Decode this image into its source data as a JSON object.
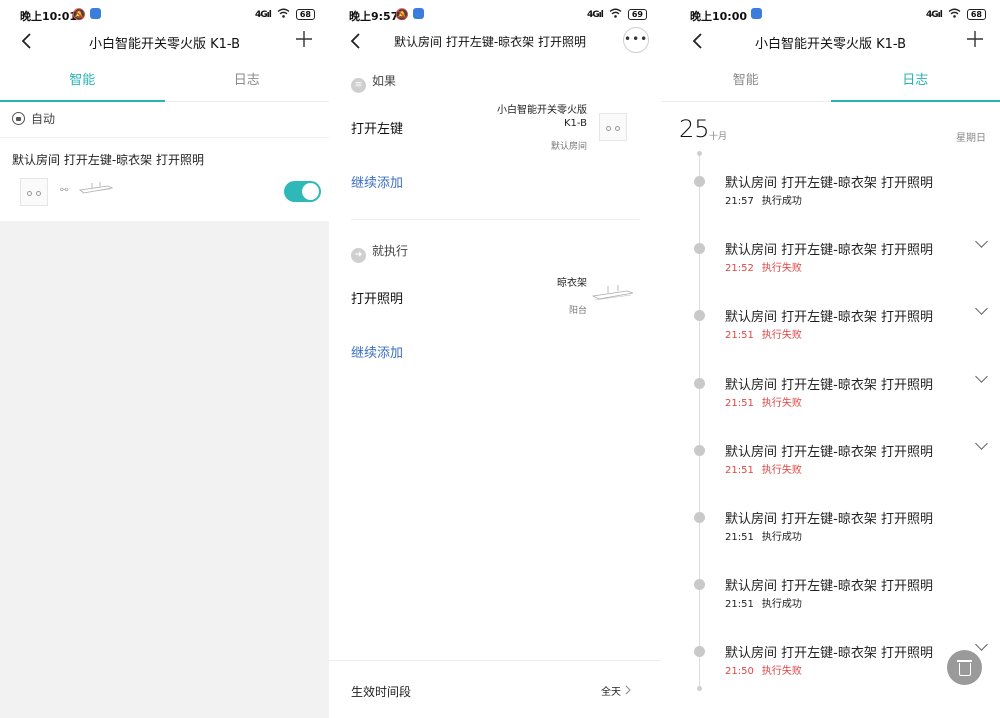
{
  "colors": {
    "accent": "#29b3b3",
    "link": "#3a6fc4",
    "fail": "#e14545",
    "success_text": "#222222"
  },
  "screens": [
    {
      "status": {
        "time": "晚上10:01",
        "signal": "4Gıl",
        "battery": "68"
      },
      "nav": {
        "title": "小白智能开关零火版 K1-B",
        "back_icon": "chevron-left-icon",
        "action_icon": "plus-icon"
      },
      "tabs": [
        {
          "label": "智能",
          "active": true
        },
        {
          "label": "日志",
          "active": false
        }
      ],
      "section": {
        "label": "自动"
      },
      "automation": {
        "name": "默认房间 打开左键-晾衣架 打开照明",
        "enabled": true
      }
    },
    {
      "status": {
        "time": "晚上9:57",
        "signal": "4Gıl",
        "battery": "69"
      },
      "nav": {
        "title": "默认房间 打开左键-晾衣架 打开照明",
        "back_icon": "chevron-left-icon",
        "action_icon": "more-icon"
      },
      "if_section": {
        "label": "如果"
      },
      "condition": {
        "action": "打开左键",
        "device_line1": "小白智能开关零火版",
        "device_line2": "K1-B",
        "room": "默认房间"
      },
      "add_more_1": "继续添加",
      "then_section": {
        "label": "就执行"
      },
      "task": {
        "action": "打开照明",
        "device": "晾衣架",
        "room": "阳台"
      },
      "add_more_2": "继续添加",
      "footer": {
        "label": "生效时间段",
        "value": "全天"
      }
    },
    {
      "status": {
        "time": "晚上10:00",
        "signal": "4Gıl",
        "battery": "68"
      },
      "nav": {
        "title": "小白智能开关零火版 K1-B",
        "back_icon": "chevron-left-icon",
        "action_icon": "plus-icon"
      },
      "tabs": [
        {
          "label": "智能",
          "active": false
        },
        {
          "label": "日志",
          "active": true
        }
      ],
      "date": {
        "day": "25",
        "month": "十月",
        "weekday": "星期日"
      },
      "logs": [
        {
          "title": "默认房间 打开左键-晾衣架 打开照明",
          "time": "21:57",
          "status": "执行成功",
          "result": "success",
          "expandable": false
        },
        {
          "title": "默认房间 打开左键-晾衣架 打开照明",
          "time": "21:52",
          "status": "执行失败",
          "result": "fail",
          "expandable": true
        },
        {
          "title": "默认房间 打开左键-晾衣架 打开照明",
          "time": "21:51",
          "status": "执行失败",
          "result": "fail",
          "expandable": true
        },
        {
          "title": "默认房间 打开左键-晾衣架 打开照明",
          "time": "21:51",
          "status": "执行失败",
          "result": "fail",
          "expandable": true
        },
        {
          "title": "默认房间 打开左键-晾衣架 打开照明",
          "time": "21:51",
          "status": "执行失败",
          "result": "fail",
          "expandable": true
        },
        {
          "title": "默认房间 打开左键-晾衣架 打开照明",
          "time": "21:51",
          "status": "执行成功",
          "result": "success",
          "expandable": false
        },
        {
          "title": "默认房间 打开左键-晾衣架 打开照明",
          "time": "21:51",
          "status": "执行成功",
          "result": "success",
          "expandable": false
        },
        {
          "title": "默认房间 打开左键-晾衣架 打开照明",
          "time": "21:50",
          "status": "执行失败",
          "result": "fail",
          "expandable": true
        }
      ],
      "fab_icon": "trash-icon"
    }
  ]
}
